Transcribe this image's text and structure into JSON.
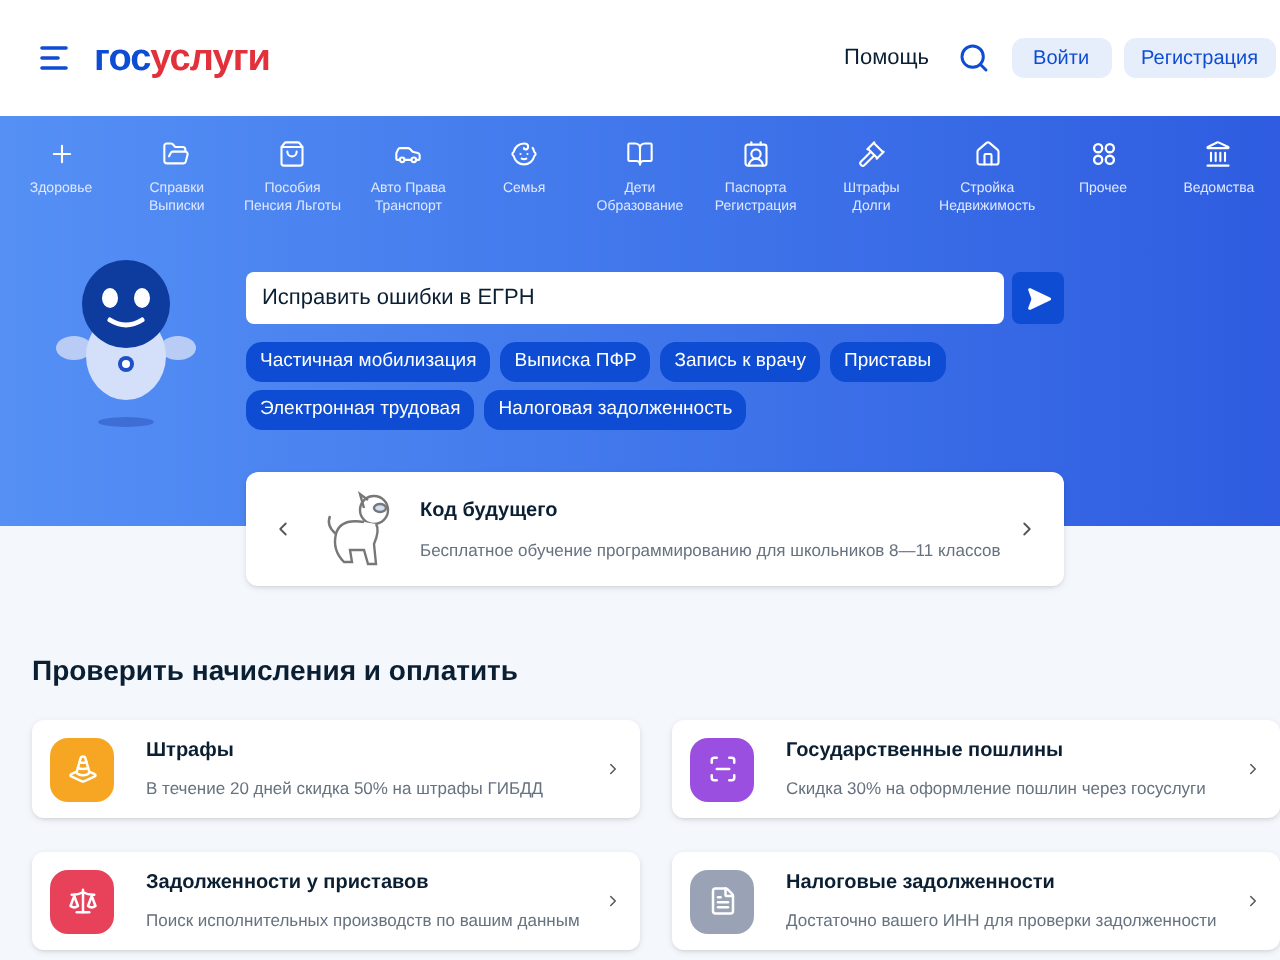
{
  "header": {
    "logo": {
      "part_1": "гос",
      "part_2": "услуги"
    },
    "help_link": "Помощь",
    "login_button": "Войти",
    "register_button": "Регистрация"
  },
  "categories": [
    {
      "kind": "health",
      "lines": [
        "Здоровье"
      ]
    },
    {
      "kind": "folder",
      "lines": [
        "Справки",
        "Выписки"
      ]
    },
    {
      "kind": "purse",
      "lines": [
        "Пособия",
        "Пенсия Льготы"
      ]
    },
    {
      "kind": "car",
      "lines": [
        "Авто Права",
        "Транспорт"
      ]
    },
    {
      "kind": "family",
      "lines": [
        "Семья"
      ]
    },
    {
      "kind": "book",
      "lines": [
        "Дети",
        "Образование"
      ]
    },
    {
      "kind": "passport",
      "lines": [
        "Паспорта",
        "Регистрация"
      ]
    },
    {
      "kind": "gavel",
      "lines": [
        "Штрафы",
        "Долги"
      ]
    },
    {
      "kind": "house",
      "lines": [
        "Стройка",
        "Недвижимость"
      ]
    },
    {
      "kind": "grid",
      "lines": [
        "Прочее"
      ]
    },
    {
      "kind": "emblem",
      "lines": [
        "Ведомства"
      ]
    }
  ],
  "search": {
    "value": "Исправить ошибки в ЕГРН"
  },
  "chips": [
    [
      "Частичная мобилизация",
      "Выписка ПФР",
      "Запись к врачу",
      "Приставы"
    ],
    [
      "Электронная трудовая",
      "Налоговая задолженность"
    ]
  ],
  "promo": {
    "title": "Код будущего",
    "text": "Бесплатное обучение программированию для школьников 8—11 классов"
  },
  "section": {
    "title": "Проверить начисления и оплатить",
    "cards": [
      {
        "kind": "traffic",
        "color": "#f6a623",
        "title": "Штрафы",
        "text": "В течение 20 дней скидка 50% на штрафы ГИБДД"
      },
      {
        "kind": "scan",
        "color": "#9b4fe0",
        "title": "Государственные пошлины",
        "text": "Скидка 30% на оформление пошлин через госуслуги"
      },
      {
        "kind": "scales",
        "color": "#e8415a",
        "title": "Задолженности у приставов",
        "text": "Поиск исполнительных производств по вашим данным"
      },
      {
        "kind": "document",
        "color": "#9aa3b5",
        "title": "Налоговые задолженности",
        "text": "Достаточно вашего ИНН для проверки задолженности"
      }
    ]
  }
}
